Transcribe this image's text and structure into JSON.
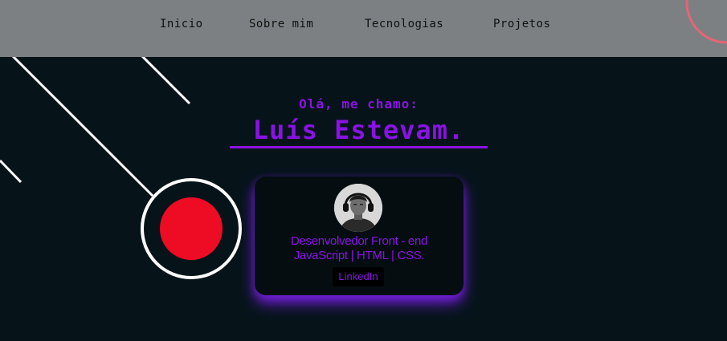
{
  "nav": {
    "items": [
      {
        "label": "Inicio"
      },
      {
        "label": "Sobre mim"
      },
      {
        "label": "Tecnologias"
      },
      {
        "label": "Projetos"
      }
    ]
  },
  "hero": {
    "greeting": "Olá, me chamo:",
    "name": "Luís Estevam."
  },
  "profile_card": {
    "role_line1": "Desenvolvedor Front - end",
    "role_line2": "JavaScript | HTML | CSS.",
    "linkedin_label": "LinkedIn"
  },
  "colors": {
    "accent": "#8a12e4",
    "background": "#06141a",
    "navbar": "#7c8082",
    "red_dot": "#ee0b24",
    "pink_ring": "#e86477"
  }
}
